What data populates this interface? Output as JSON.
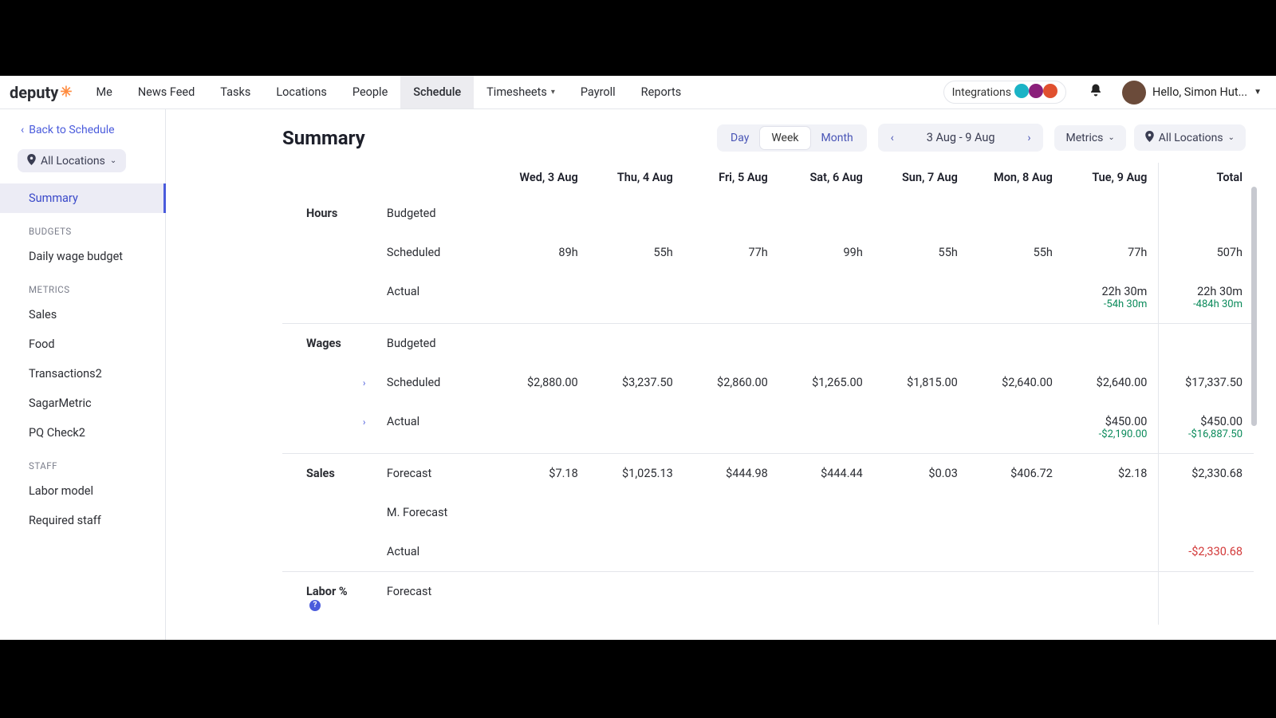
{
  "brand": {
    "name": "deputy"
  },
  "nav": {
    "items": [
      "Me",
      "News Feed",
      "Tasks",
      "Locations",
      "People",
      "Schedule",
      "Timesheets",
      "Payroll",
      "Reports"
    ],
    "active": "Schedule",
    "with_caret": [
      "Timesheets"
    ]
  },
  "header_right": {
    "integrations_label": "Integrations",
    "int_colors": [
      "#1bb3c6",
      "#8a1f7a",
      "#e0502f"
    ],
    "user_greeting": "Hello, Simon Hut..."
  },
  "sidebar": {
    "back_label": "Back to Schedule",
    "location_filter": "All Locations",
    "summary_label": "Summary",
    "sections": [
      {
        "title": "BUDGETS",
        "items": [
          "Daily wage budget"
        ]
      },
      {
        "title": "METRICS",
        "items": [
          "Sales",
          "Food",
          "Transactions2",
          "SagarMetric",
          "PQ Check2"
        ]
      },
      {
        "title": "STAFF",
        "items": [
          "Labor model",
          "Required staff"
        ]
      }
    ]
  },
  "toolbar": {
    "title": "Summary",
    "range_modes": [
      "Day",
      "Week",
      "Month"
    ],
    "range_active": "Week",
    "date_range": "3 Aug - 9 Aug",
    "metrics_label": "Metrics",
    "locations_label": "All Locations"
  },
  "columns": [
    "Wed, 3 Aug",
    "Thu, 4 Aug",
    "Fri, 5 Aug",
    "Sat, 6 Aug",
    "Sun, 7 Aug",
    "Mon, 8 Aug",
    "Tue, 9 Aug"
  ],
  "total_label": "Total",
  "groups": [
    {
      "name": "Hours",
      "rows": [
        {
          "label": "Budgeted",
          "vals": [
            "",
            "",
            "",
            "",
            "",
            "",
            ""
          ],
          "total": ""
        },
        {
          "label": "Scheduled",
          "vals": [
            "89h",
            "55h",
            "77h",
            "99h",
            "55h",
            "55h",
            "77h"
          ],
          "total": "507h"
        },
        {
          "label": "Actual",
          "vals": [
            "",
            "",
            "",
            "",
            "",
            "",
            "22h 30m"
          ],
          "sub": [
            "",
            "",
            "",
            "",
            "",
            "",
            "-54h 30m"
          ],
          "total": "22h 30m",
          "total_sub": "-484h 30m"
        }
      ]
    },
    {
      "name": "Wages",
      "rows": [
        {
          "label": "Budgeted",
          "vals": [
            "",
            "",
            "",
            "",
            "",
            "",
            ""
          ],
          "total": ""
        },
        {
          "label": "Scheduled",
          "expandable": true,
          "vals": [
            "$2,880.00",
            "$3,237.50",
            "$2,860.00",
            "$1,265.00",
            "$1,815.00",
            "$2,640.00",
            "$2,640.00"
          ],
          "total": "$17,337.50"
        },
        {
          "label": "Actual",
          "expandable": true,
          "vals": [
            "",
            "",
            "",
            "",
            "",
            "",
            "$450.00"
          ],
          "sub": [
            "",
            "",
            "",
            "",
            "",
            "",
            "-$2,190.00"
          ],
          "total": "$450.00",
          "total_sub": "-$16,887.50"
        }
      ]
    },
    {
      "name": "Sales",
      "rows": [
        {
          "label": "Forecast",
          "vals": [
            "$7.18",
            "$1,025.13",
            "$444.98",
            "$444.44",
            "$0.03",
            "$406.72",
            "$2.18"
          ],
          "total": "$2,330.68"
        },
        {
          "label": "M. Forecast",
          "vals": [
            "",
            "",
            "",
            "",
            "",
            "",
            ""
          ],
          "total": ""
        },
        {
          "label": "Actual",
          "vals": [
            "",
            "",
            "",
            "",
            "",
            "",
            ""
          ],
          "total": "-$2,330.68",
          "total_neg": true
        }
      ]
    },
    {
      "name": "Labor %",
      "help": true,
      "rows": [
        {
          "label": "Forecast",
          "vals": [
            "",
            "",
            "",
            "",
            "",
            "",
            ""
          ],
          "total": ""
        }
      ]
    }
  ]
}
